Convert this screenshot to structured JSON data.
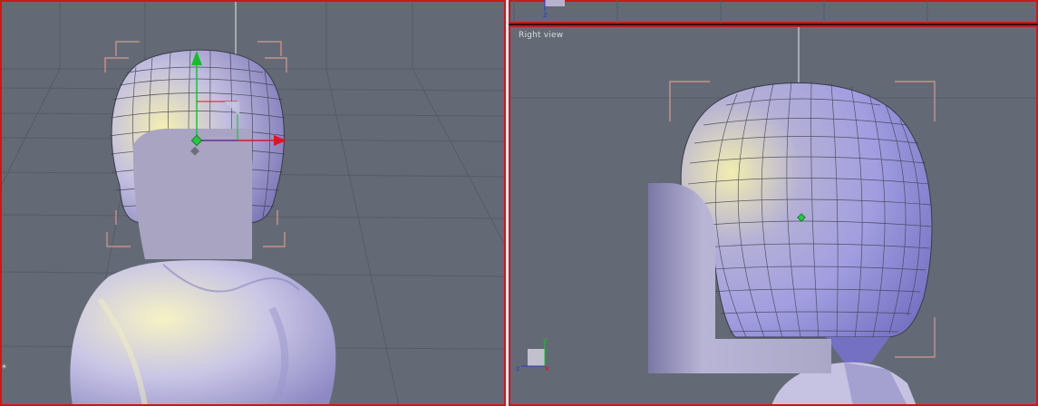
{
  "viewports": {
    "left": {
      "label": "",
      "marker": "*"
    },
    "top_strip": {
      "axis_label": "z"
    },
    "right": {
      "label": "Right view",
      "axis_z": "z",
      "axis_y": "y",
      "axis_x": "x"
    }
  },
  "colors": {
    "viewport_bg": "#646a75",
    "grid": "#565c66",
    "active_border": "#d41414",
    "bracket": "#d49a8e",
    "mesh_lilac": "#a5a1d0",
    "mesh_yellow": "#f4efb0",
    "gizmo_x": "#e0161e",
    "gizmo_y": "#12c026",
    "gizmo_z": "#2a3ad0",
    "pivot": "#19d036"
  },
  "icons": [
    "move-gizmo-icon",
    "axis-tripod-icon",
    "pivot-point-icon"
  ]
}
